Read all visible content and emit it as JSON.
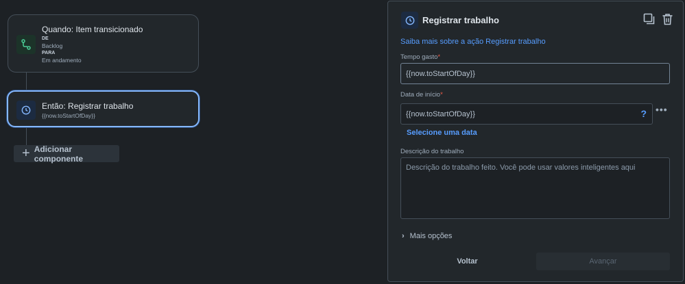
{
  "canvas": {
    "trigger": {
      "title": "Quando: Item transicionado",
      "from_label": "DE",
      "from_value": "Backlog",
      "to_label": "PARA",
      "to_value": "Em andamento",
      "icon": "transition-icon"
    },
    "action": {
      "title": "Então: Registrar trabalho",
      "subtitle": "{{now.toStartOfDay}}",
      "icon": "clock-icon"
    },
    "add_component_label": "Adicionar componente"
  },
  "panel": {
    "title": "Registrar trabalho",
    "icon": "clock-icon",
    "learn_more": "Saiba mais sobre a ação Registrar trabalho",
    "time_spent": {
      "label": "Tempo gasto",
      "required_mark": "*",
      "value": "{{now.toStartOfDay}}"
    },
    "start_date": {
      "label": "Data de início",
      "required_mark": "*",
      "value": "{{now.toStartOfDay}}",
      "help": "?",
      "more": "•••",
      "select_date": "Selecione uma data"
    },
    "description": {
      "label": "Descrição do trabalho",
      "placeholder": "Descrição do trabalho feito. Você pode usar valores inteligentes aqui"
    },
    "more_options": "Mais opções",
    "back_button": "Voltar",
    "next_button": "Avançar"
  },
  "colors": {
    "background": "#1d2125",
    "accent": "#579dff",
    "selected_border": "#85b8ff",
    "required": "#ef5c48"
  }
}
